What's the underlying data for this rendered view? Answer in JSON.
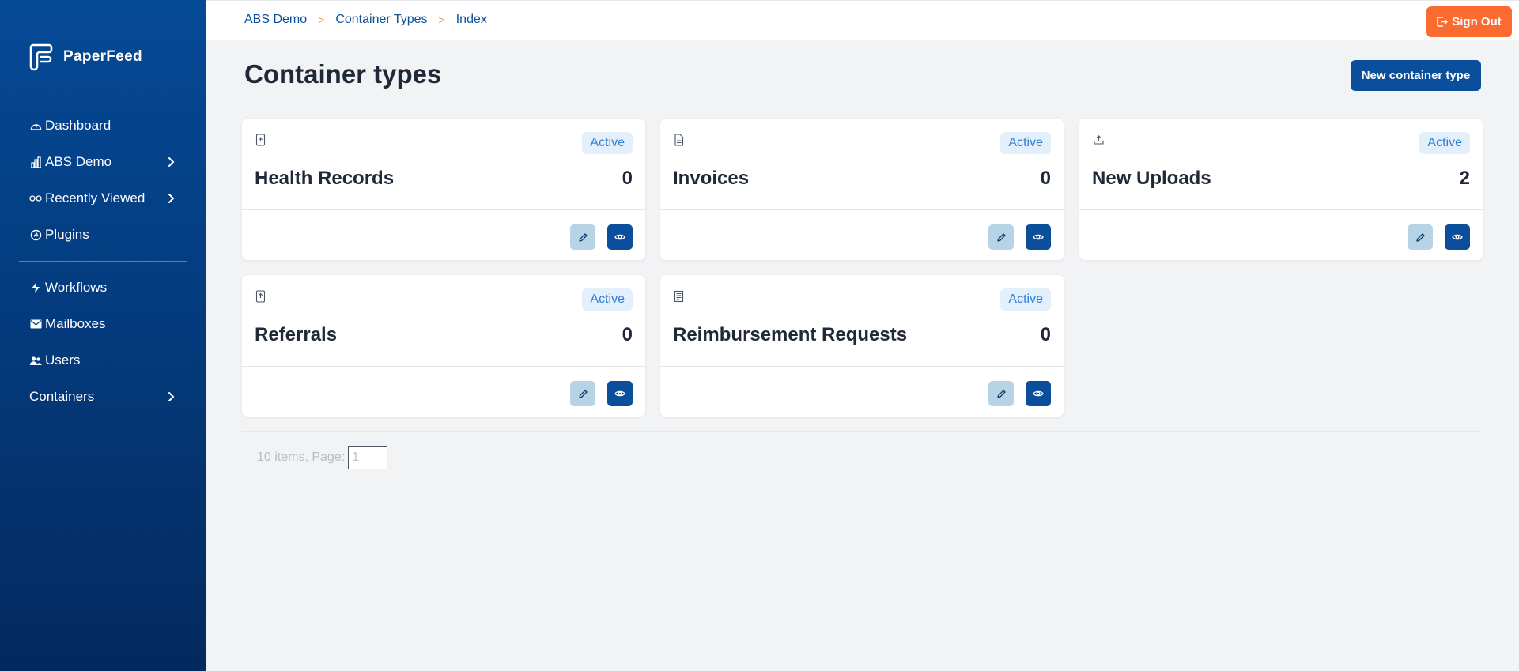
{
  "app": {
    "name": "PaperFeed"
  },
  "sidebar": {
    "items": [
      {
        "label": "Dashboard",
        "icon": "dashboard-gauge-icon",
        "has_children": false
      },
      {
        "label": "ABS Demo",
        "icon": "building-chart-icon",
        "has_children": true
      },
      {
        "label": "Recently Viewed",
        "icon": "glasses-icon",
        "has_children": true
      },
      {
        "label": "Plugins",
        "icon": "plugin-circle-icon",
        "has_children": false
      }
    ],
    "items2": [
      {
        "label": "Workflows",
        "icon": "lightning-icon",
        "has_children": false
      },
      {
        "label": "Mailboxes",
        "icon": "envelope-icon",
        "has_children": false
      },
      {
        "label": "Users",
        "icon": "users-icon",
        "has_children": false
      },
      {
        "label": "Containers",
        "icon": "",
        "has_children": true
      }
    ]
  },
  "breadcrumb": [
    "ABS Demo",
    "Container Types",
    "Index"
  ],
  "breadcrumb_separator": ">",
  "header": {
    "signout_label": "Sign Out"
  },
  "page": {
    "title": "Container types",
    "new_button_label": "New container type"
  },
  "cards": [
    {
      "name": "Health Records",
      "count": "0",
      "status": "Active",
      "icon": "medical-document-icon"
    },
    {
      "name": "Invoices",
      "count": "0",
      "status": "Active",
      "icon": "document-icon"
    },
    {
      "name": "New Uploads",
      "count": "2",
      "status": "Active",
      "icon": "upload-icon"
    },
    {
      "name": "Referrals",
      "count": "0",
      "status": "Active",
      "icon": "referral-document-icon"
    },
    {
      "name": "Reimbursement Requests",
      "count": "0",
      "status": "Active",
      "icon": "receipt-icon"
    }
  ],
  "pager": {
    "summary": "10 items, Page:",
    "page_value": "1"
  },
  "colors": {
    "sidebar": "#054a96",
    "primary": "#0b4f9c",
    "signout": "#fb6b30",
    "badge_bg": "#e3effb",
    "badge_text": "#2f7fd4",
    "edit_bg": "#b7d4e6"
  }
}
